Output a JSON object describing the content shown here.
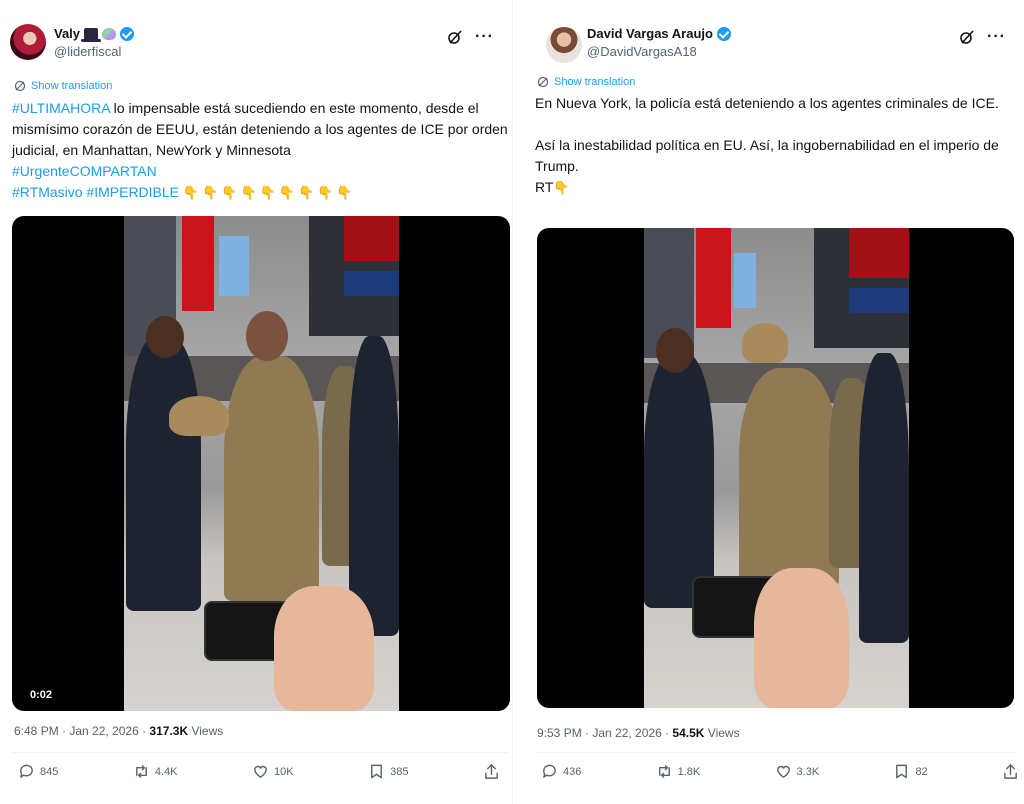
{
  "tweets": [
    {
      "display_name": "Valy",
      "handle": "@liderfiscal",
      "show_translation": "Show translation",
      "text": {
        "h1": "#ULTIMAHORA",
        "t1": " lo impensable está sucediendo en este momento, desde el mismísimo corazón de EEUU, están deteniendo a los agentes de ICE por orden judicial, en Manhattan, NewYork y Minnesota",
        "h2": "#UrgenteCOMPARTAN",
        "h3": "#RTMasivo",
        "h4": "#IMPERDIBLE",
        "emoji_count": 9,
        "emoji": "👇"
      },
      "video_time": "0:02",
      "time": "6:48 PM · Jan 22, 2026 · ",
      "views_count": "317.3K",
      "views_label": " Views",
      "replies": "845",
      "reposts": "4.4K",
      "likes": "10K",
      "bookmarks": "385"
    },
    {
      "display_name": "David Vargas Araujo",
      "handle": "@DavidVargasA18",
      "show_translation": "Show translation",
      "text": {
        "p1": "En Nueva York, la policía está deteniendo a los agentes criminales de ICE.",
        "p2": "Así la inestabilidad política en EU. Así, la ingobernabilidad en el imperio de Trump.",
        "p3": "RT",
        "emoji": "👇"
      },
      "time": "9:53 PM · Jan 22, 2026 · ",
      "views_count": "54.5K",
      "views_label": " Views",
      "replies": "436",
      "reposts": "1.8K",
      "likes": "3.3K",
      "bookmarks": "82"
    }
  ],
  "colors": {
    "link": "#1d9bf0",
    "text": "#0f1419",
    "muted": "#536471"
  }
}
